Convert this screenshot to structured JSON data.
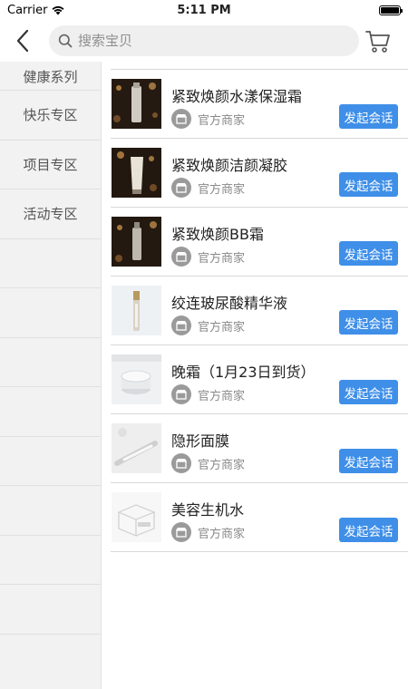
{
  "status_bar": {
    "carrier": "Carrier",
    "time": "5:11 PM",
    "battery_level": 1.0
  },
  "nav": {
    "back_icon": "chevron-left-icon",
    "search_placeholder": "搜索宝贝",
    "search_value": "",
    "cart_icon": "cart-icon"
  },
  "sidebar": {
    "items": [
      {
        "label": "健康系列"
      },
      {
        "label": "快乐专区"
      },
      {
        "label": "项目专区"
      },
      {
        "label": "活动专区"
      },
      {
        "label": ""
      },
      {
        "label": ""
      },
      {
        "label": ""
      },
      {
        "label": ""
      },
      {
        "label": ""
      },
      {
        "label": ""
      },
      {
        "label": ""
      },
      {
        "label": ""
      }
    ]
  },
  "products": [
    {
      "title": "紧致焕颜水漾保湿霜",
      "merchant": "官方商家",
      "button": "发起会话",
      "thumb": "dark-bottle"
    },
    {
      "title": "紧致焕颜洁颜凝胶",
      "merchant": "官方商家",
      "button": "发起会话",
      "thumb": "dark-tube"
    },
    {
      "title": "紧致焕颜BB霜",
      "merchant": "官方商家",
      "button": "发起会话",
      "thumb": "dark-bottle"
    },
    {
      "title": "绞连玻尿酸精华液",
      "merchant": "官方商家",
      "button": "发起会话",
      "thumb": "light-vial"
    },
    {
      "title": "晚霜（1月23日到货）",
      "merchant": "官方商家",
      "button": "发起会话",
      "thumb": "light-jar"
    },
    {
      "title": "隐形面膜",
      "merchant": "官方商家",
      "button": "发起会话",
      "thumb": "light-pen"
    },
    {
      "title": "美容生机水",
      "merchant": "官方商家",
      "button": "发起会话",
      "thumb": "empty-box"
    }
  ],
  "colors": {
    "accent": "#3f8fe8",
    "sidebar_bg": "#f2f2f2"
  }
}
